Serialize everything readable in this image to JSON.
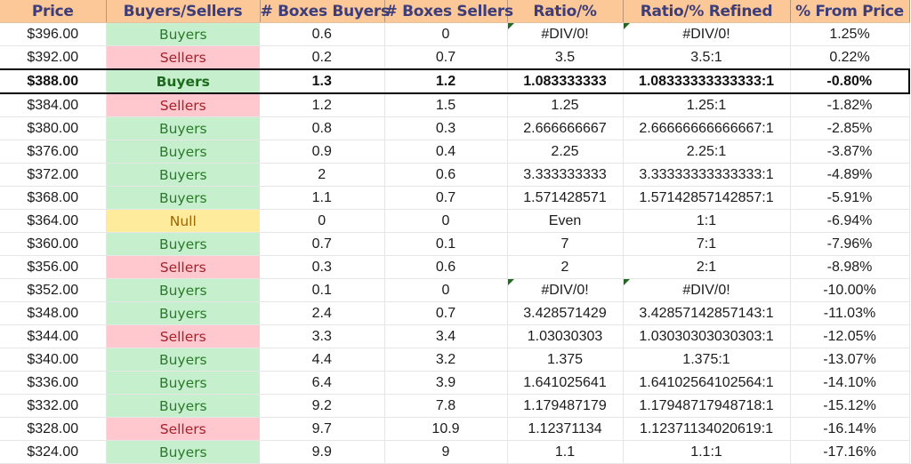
{
  "headers": [
    "Price",
    "Buyers/Sellers",
    "# Boxes Buyers",
    "# Boxes Sellers",
    "Ratio/%",
    "Ratio/% Refined",
    "% From Price"
  ],
  "current_price_row_index": 2,
  "rows": [
    {
      "price": "$396.00",
      "side": "Buyers",
      "buyers": "0.6",
      "sellers": "0",
      "ratio": "#DIV/0!",
      "refined": "#DIV/0!",
      "from_price": "1.25%"
    },
    {
      "price": "$392.00",
      "side": "Sellers",
      "buyers": "0.2",
      "sellers": "0.7",
      "ratio": "3.5",
      "refined": "3.5:1",
      "from_price": "0.22%"
    },
    {
      "price": "$388.00",
      "side": "Buyers",
      "buyers": "1.3",
      "sellers": "1.2",
      "ratio": "1.083333333",
      "refined": "1.08333333333333:1",
      "from_price": "-0.80%"
    },
    {
      "price": "$384.00",
      "side": "Sellers",
      "buyers": "1.2",
      "sellers": "1.5",
      "ratio": "1.25",
      "refined": "1.25:1",
      "from_price": "-1.82%"
    },
    {
      "price": "$380.00",
      "side": "Buyers",
      "buyers": "0.8",
      "sellers": "0.3",
      "ratio": "2.666666667",
      "refined": "2.66666666666667:1",
      "from_price": "-2.85%"
    },
    {
      "price": "$376.00",
      "side": "Buyers",
      "buyers": "0.9",
      "sellers": "0.4",
      "ratio": "2.25",
      "refined": "2.25:1",
      "from_price": "-3.87%"
    },
    {
      "price": "$372.00",
      "side": "Buyers",
      "buyers": "2",
      "sellers": "0.6",
      "ratio": "3.333333333",
      "refined": "3.33333333333333:1",
      "from_price": "-4.89%"
    },
    {
      "price": "$368.00",
      "side": "Buyers",
      "buyers": "1.1",
      "sellers": "0.7",
      "ratio": "1.571428571",
      "refined": "1.57142857142857:1",
      "from_price": "-5.91%"
    },
    {
      "price": "$364.00",
      "side": "Null",
      "buyers": "0",
      "sellers": "0",
      "ratio": "Even",
      "refined": "1:1",
      "from_price": "-6.94%"
    },
    {
      "price": "$360.00",
      "side": "Buyers",
      "buyers": "0.7",
      "sellers": "0.1",
      "ratio": "7",
      "refined": "7:1",
      "from_price": "-7.96%"
    },
    {
      "price": "$356.00",
      "side": "Sellers",
      "buyers": "0.3",
      "sellers": "0.6",
      "ratio": "2",
      "refined": "2:1",
      "from_price": "-8.98%"
    },
    {
      "price": "$352.00",
      "side": "Buyers",
      "buyers": "0.1",
      "sellers": "0",
      "ratio": "#DIV/0!",
      "refined": "#DIV/0!",
      "from_price": "-10.00%"
    },
    {
      "price": "$348.00",
      "side": "Buyers",
      "buyers": "2.4",
      "sellers": "0.7",
      "ratio": "3.428571429",
      "refined": "3.42857142857143:1",
      "from_price": "-11.03%"
    },
    {
      "price": "$344.00",
      "side": "Sellers",
      "buyers": "3.3",
      "sellers": "3.4",
      "ratio": "1.03030303",
      "refined": "1.03030303030303:1",
      "from_price": "-12.05%"
    },
    {
      "price": "$340.00",
      "side": "Buyers",
      "buyers": "4.4",
      "sellers": "3.2",
      "ratio": "1.375",
      "refined": "1.375:1",
      "from_price": "-13.07%"
    },
    {
      "price": "$336.00",
      "side": "Buyers",
      "buyers": "6.4",
      "sellers": "3.9",
      "ratio": "1.641025641",
      "refined": "1.64102564102564:1",
      "from_price": "-14.10%"
    },
    {
      "price": "$332.00",
      "side": "Buyers",
      "buyers": "9.2",
      "sellers": "7.8",
      "ratio": "1.179487179",
      "refined": "1.17948717948718:1",
      "from_price": "-15.12%"
    },
    {
      "price": "$328.00",
      "side": "Sellers",
      "buyers": "9.7",
      "sellers": "10.9",
      "ratio": "1.12371134",
      "refined": "1.12371134020619:1",
      "from_price": "-16.14%"
    },
    {
      "price": "$324.00",
      "side": "Buyers",
      "buyers": "9.9",
      "sellers": "9",
      "ratio": "1.1",
      "refined": "1.1:1",
      "from_price": "-17.16%"
    }
  ],
  "colors": {
    "header_bg": "#fdc898",
    "header_text": "#3d3d7a",
    "buyers_bg": "#c6efce",
    "buyers_text": "#2a7a2a",
    "sellers_bg": "#ffc7ce",
    "sellers_text": "#a8202a",
    "null_bg": "#ffeb9c",
    "null_text": "#9c6500",
    "error_marker": "#1e6b1e"
  }
}
